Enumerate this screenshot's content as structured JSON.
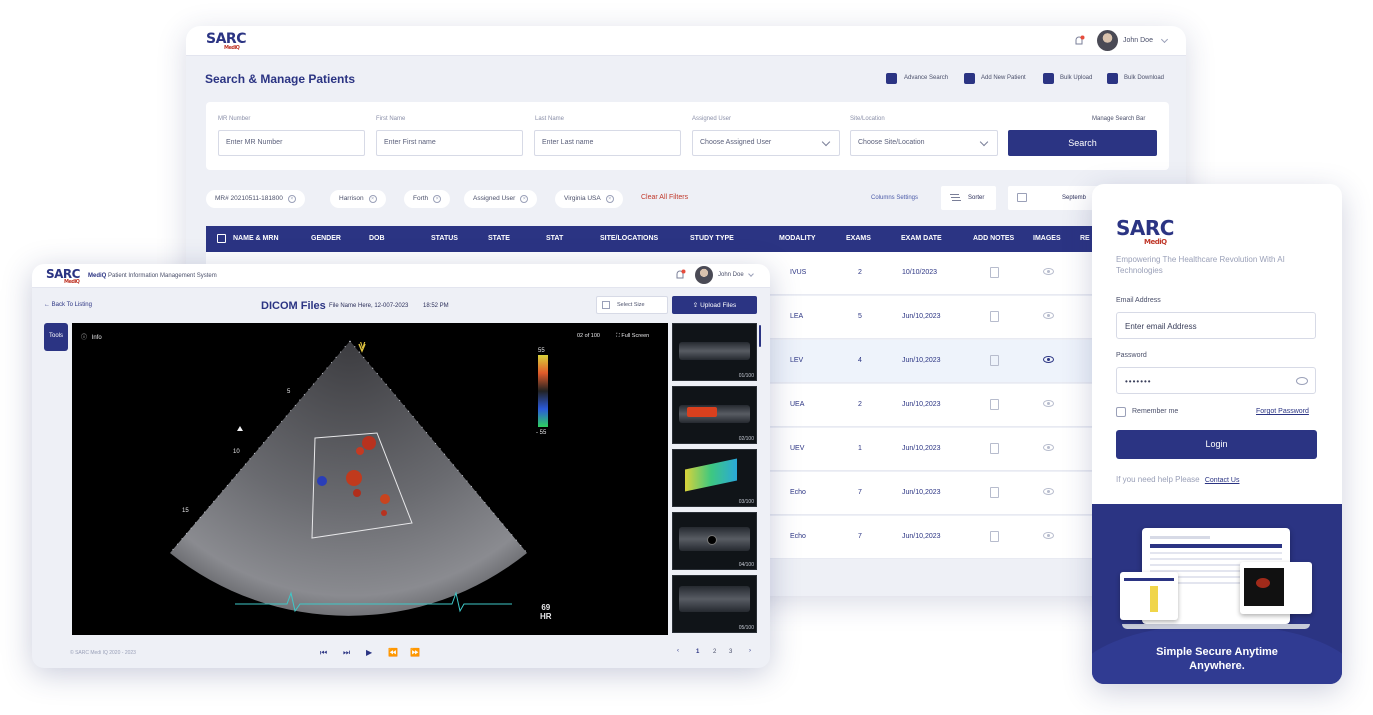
{
  "colors": {
    "brand": "#2b3483",
    "accent": "#c0392b",
    "table_header": "#2b3483"
  },
  "brand": {
    "logo": "SARC",
    "logo_sub": "MediQ"
  },
  "user": {
    "name": "John Doe"
  },
  "patients": {
    "title": "Search & Manage Patients",
    "actions": [
      "Advance Search",
      "Add New Patient",
      "Bulk Upload",
      "Bulk Download"
    ],
    "manage_search_bar": "Manage Search Bar",
    "fields": {
      "mr": {
        "label": "MR Number",
        "placeholder": "Enter MR Number"
      },
      "first": {
        "label": "First Name",
        "placeholder": "Enter First name"
      },
      "last": {
        "label": "Last Name",
        "placeholder": "Enter Last name"
      },
      "assigned": {
        "label": "Assigned User",
        "placeholder": "Choose Assigned User"
      },
      "site": {
        "label": "Site/Location",
        "placeholder": "Choose Site/Location"
      }
    },
    "search_label": "Search",
    "chips": [
      "MR# 20210511-181800",
      "Harrison",
      "Forth",
      "Assigned User",
      "Virginia USA"
    ],
    "clear_filters": "Clear All Filters",
    "columns_settings": "Columns Settings",
    "sorter": "Sorter",
    "date_value": "Septemb",
    "columns": [
      "NAME & MRN",
      "GENDER",
      "DOB",
      "STATUS",
      "STATE",
      "STAT",
      "SITE/LOCATIONS",
      "STUDY TYPE",
      "MODALITY",
      "EXAMS",
      "EXAM DATE",
      "ADD NOTES",
      "IMAGES",
      "RE"
    ],
    "rows": [
      {
        "modality": "IVUS",
        "exams": "2",
        "date": "10/10/2023"
      },
      {
        "modality": "LEA",
        "exams": "5",
        "date": "Jun/10,2023"
      },
      {
        "modality": "LEV",
        "exams": "4",
        "date": "Jun/10,2023"
      },
      {
        "modality": "UEA",
        "exams": "2",
        "date": "Jun/10,2023"
      },
      {
        "modality": "UEV",
        "exams": "1",
        "date": "Jun/10,2023"
      },
      {
        "modality": "Echo",
        "exams": "7",
        "date": "Jun/10,2023"
      },
      {
        "modality": "Echo",
        "exams": "7",
        "date": "Jun/10,2023"
      }
    ]
  },
  "dicom": {
    "app_name": "MediQ",
    "app_title": "Patient Information Management System",
    "back": "Back To Listing",
    "title": "DICOM Files",
    "file_info": "File Name Here, 12-007-2023",
    "time": "18:52 PM",
    "select_size": "Select Size",
    "upload": "Upload Files",
    "tools": "Tools",
    "info": "Info",
    "counter": "02 of 100",
    "full_screen": "Full Screen",
    "scale": {
      "top": "55",
      "bottom": "- 55"
    },
    "depth_marks": [
      "5",
      "10",
      "15"
    ],
    "probe_marker": "V",
    "hr_value": "69",
    "hr_label": "HR",
    "thumbs": [
      "01/100",
      "02/100",
      "03/100",
      "04/100",
      "05/100"
    ],
    "copyright": "© SARC Medi IQ 2020 - 2023",
    "pages": [
      "1",
      "2",
      "3"
    ]
  },
  "login": {
    "tagline": "Empowering The Healthcare Revolution With AI Technologies",
    "email_label": "Email Address",
    "email_placeholder": "Enter email Address",
    "password_label": "Password",
    "password_value": "•••••••",
    "remember": "Remember me",
    "forgot": "Forgot Password",
    "login_button": "Login",
    "help": "If you need help Please",
    "contact": "Contact Us",
    "footer_line1": "Simple Secure Anytime",
    "footer_line2": "Anywhere."
  }
}
